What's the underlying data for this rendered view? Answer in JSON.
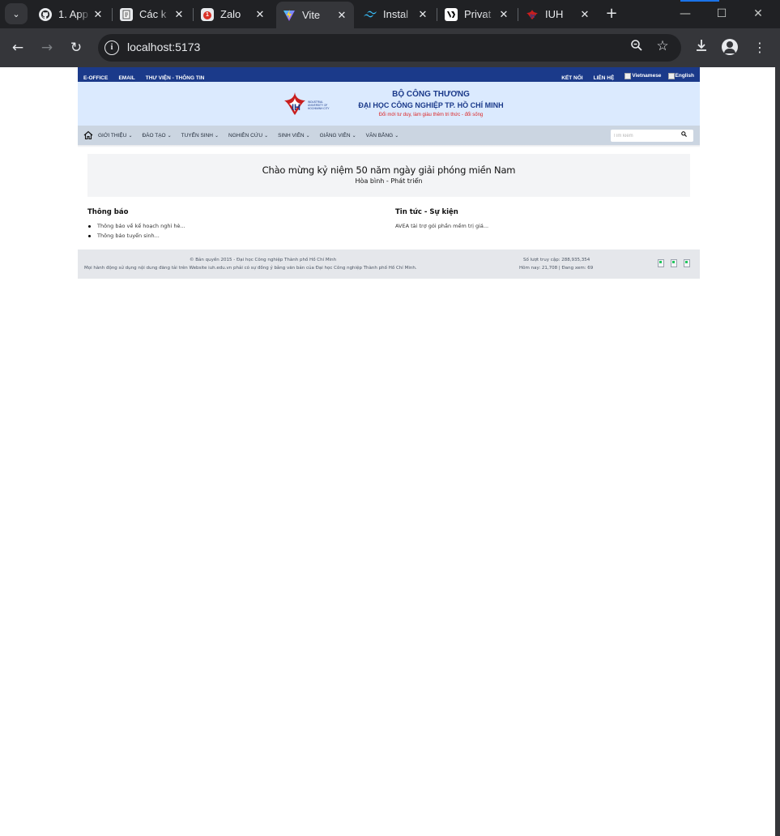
{
  "browser": {
    "tabs": [
      {
        "title": "1. App",
        "icon": "github-icon",
        "active": false
      },
      {
        "title": "Các k",
        "icon": "document-icon",
        "active": false
      },
      {
        "title": "Zalo",
        "icon": "zalo-icon",
        "badge": "1",
        "active": false
      },
      {
        "title": "Vite",
        "icon": "vite-icon",
        "active": true
      },
      {
        "title": "Instal",
        "icon": "tailwind-icon",
        "active": false
      },
      {
        "title": "Privat",
        "icon": "vercel-icon",
        "active": false
      },
      {
        "title": "IUH",
        "icon": "iuh-icon",
        "active": false
      }
    ],
    "close_glyph": "✕",
    "new_tab_glyph": "+",
    "url": "localhost:5173",
    "window_controls": {
      "minimize": "—",
      "maximize": "☐",
      "close": "✕"
    }
  },
  "site": {
    "topbar": {
      "left_links": [
        "E-OFFICE",
        "EMAIL",
        "THƯ VIỆN - THÔNG TIN"
      ],
      "right_links": [
        "KẾT NỐI",
        "LIÊN HỆ"
      ],
      "languages": [
        "Vietnamese",
        "English"
      ]
    },
    "header": {
      "logo_text": "INDUSTRIAL UNIVERSITY OF HOCHIMINH CITY",
      "ministry": "BỘ CÔNG THƯƠNG",
      "university": "ĐẠI HỌC CÔNG NGHIỆP TP. HỒ CHÍ MINH",
      "slogan": "Đổi mới tư duy, làm giàu thêm tri thức - đổi sống"
    },
    "nav": {
      "items": [
        "GIỚI THIỆU",
        "ĐÀO TẠO",
        "TUYỂN SINH",
        "NGHIÊN CỨU",
        "SINH VIÊN",
        "GIẢNG VIÊN",
        "VĂN BẰNG"
      ],
      "search_placeholder": "Tìm kiếm"
    },
    "banner": {
      "title": "Chào mừng kỷ niệm 50 năm ngày giải phóng miền Nam",
      "subtitle": "Hòa bình - Phát triển"
    },
    "announcements": {
      "heading": "Thông báo",
      "items": [
        "Thông báo về kế hoạch nghỉ hè...",
        "Thông báo tuyển sinh..."
      ]
    },
    "news": {
      "heading": "Tin tức - Sự kiện",
      "item": "AVEA tài trợ gói phần mềm trị giá..."
    },
    "footer": {
      "copyright": "© Bản quyền 2015 - Đại học Công nghiệp Thành phố Hồ Chí Minh",
      "notice": "Mọi hành động sử dụng nội dung đăng tải trên Website iuh.edu.vn phải có sự đồng ý bằng văn bản của Đại học Công nghiệp Thành phố Hồ Chí Minh.",
      "visits": "Số lượt truy cập: 288,935,354",
      "today": "Hôm nay: 21,708 | Đang xem: 69"
    }
  }
}
